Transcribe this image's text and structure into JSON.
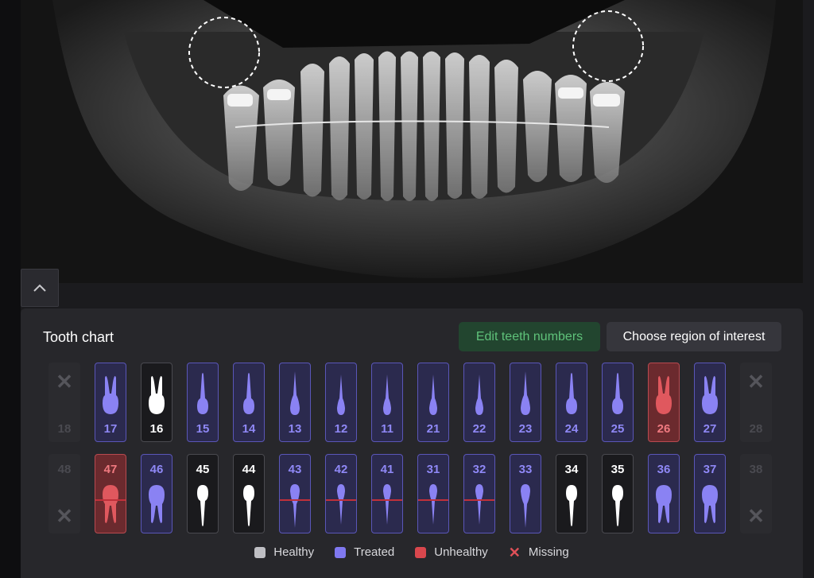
{
  "panel": {
    "title": "Tooth chart",
    "edit_button": "Edit teeth numbers",
    "roi_button": "Choose region of interest"
  },
  "colors": {
    "healthy": "#ffffff",
    "treated": "#8a82f3",
    "unhealthy": "#e0585e",
    "missing_x": "#55555b",
    "legend_healthy": "#bfbfc4",
    "legend_treated": "#7f78f0",
    "legend_unhealthy": "#d9474d",
    "legend_missing": "#e05058"
  },
  "icons": {
    "collapse": "chevron-up-icon",
    "missing": "x-icon"
  },
  "upper_teeth": [
    {
      "number": "18",
      "status": "missing",
      "shape": "none"
    },
    {
      "number": "17",
      "status": "treated",
      "shape": "molar"
    },
    {
      "number": "16",
      "status": "healthy",
      "shape": "molar"
    },
    {
      "number": "15",
      "status": "treated",
      "shape": "premolar"
    },
    {
      "number": "14",
      "status": "treated",
      "shape": "premolar"
    },
    {
      "number": "13",
      "status": "treated",
      "shape": "canine"
    },
    {
      "number": "12",
      "status": "treated",
      "shape": "incisor"
    },
    {
      "number": "11",
      "status": "treated",
      "shape": "incisor"
    },
    {
      "number": "21",
      "status": "treated",
      "shape": "incisor"
    },
    {
      "number": "22",
      "status": "treated",
      "shape": "incisor"
    },
    {
      "number": "23",
      "status": "treated",
      "shape": "canine"
    },
    {
      "number": "24",
      "status": "treated",
      "shape": "premolar"
    },
    {
      "number": "25",
      "status": "treated",
      "shape": "premolar"
    },
    {
      "number": "26",
      "status": "unhealthy",
      "shape": "molar"
    },
    {
      "number": "27",
      "status": "treated",
      "shape": "molar"
    },
    {
      "number": "28",
      "status": "missing",
      "shape": "none"
    }
  ],
  "lower_teeth": [
    {
      "number": "48",
      "status": "missing",
      "shape": "none",
      "rootline": false
    },
    {
      "number": "47",
      "status": "unhealthy",
      "shape": "molar",
      "rootline": true
    },
    {
      "number": "46",
      "status": "treated",
      "shape": "molar",
      "rootline": false
    },
    {
      "number": "45",
      "status": "healthy",
      "shape": "premolar",
      "rootline": false
    },
    {
      "number": "44",
      "status": "healthy",
      "shape": "premolar",
      "rootline": false
    },
    {
      "number": "43",
      "status": "treated",
      "shape": "canine",
      "rootline": true
    },
    {
      "number": "42",
      "status": "treated",
      "shape": "incisor",
      "rootline": true
    },
    {
      "number": "41",
      "status": "treated",
      "shape": "incisor",
      "rootline": true
    },
    {
      "number": "31",
      "status": "treated",
      "shape": "incisor",
      "rootline": true
    },
    {
      "number": "32",
      "status": "treated",
      "shape": "incisor",
      "rootline": true
    },
    {
      "number": "33",
      "status": "treated",
      "shape": "canine",
      "rootline": false
    },
    {
      "number": "34",
      "status": "healthy",
      "shape": "premolar",
      "rootline": false
    },
    {
      "number": "35",
      "status": "healthy",
      "shape": "premolar",
      "rootline": false
    },
    {
      "number": "36",
      "status": "treated",
      "shape": "molar",
      "rootline": false
    },
    {
      "number": "37",
      "status": "treated",
      "shape": "molar",
      "rootline": false
    },
    {
      "number": "38",
      "status": "missing",
      "shape": "none",
      "rootline": false
    }
  ],
  "legend": [
    {
      "label": "Healthy",
      "key": "legend_healthy",
      "kind": "swatch"
    },
    {
      "label": "Treated",
      "key": "legend_treated",
      "kind": "swatch"
    },
    {
      "label": "Unhealthy",
      "key": "legend_unhealthy",
      "kind": "swatch"
    },
    {
      "label": "Missing",
      "key": "legend_missing",
      "kind": "x"
    }
  ]
}
